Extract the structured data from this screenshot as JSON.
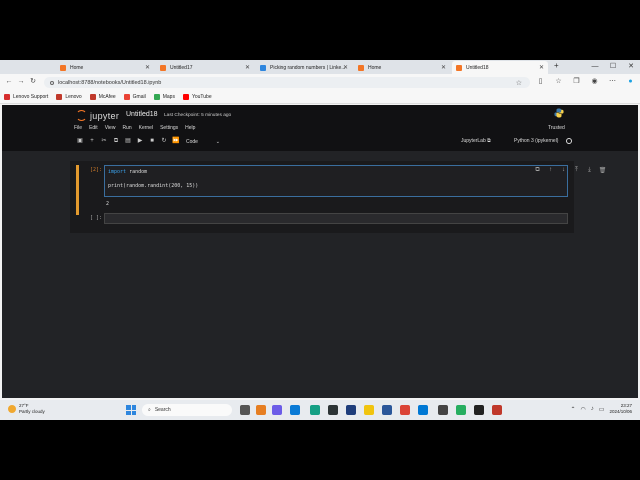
{
  "browser": {
    "tabs": [
      {
        "label": "Home",
        "color": "#f37626"
      },
      {
        "label": "Untitled17",
        "color": "#f37626"
      },
      {
        "label": "Picking random numbers | Linke...",
        "color": "#2e86de"
      },
      {
        "label": "Home",
        "color": "#f37626"
      },
      {
        "label": "Untitled18",
        "color": "#f37626"
      }
    ],
    "new_tab": "+",
    "url": "localhost:8788/notebooks/Untitled18.ipynb",
    "bookmarks": [
      {
        "label": "Lenovo Support",
        "color": "#d62d2d"
      },
      {
        "label": "Lenovo",
        "color": "#c0392b"
      },
      {
        "label": "McAfee",
        "color": "#c0392b"
      },
      {
        "label": "Gmail",
        "color": "#ea4335"
      },
      {
        "label": "Maps",
        "color": "#34a853"
      },
      {
        "label": "YouTube",
        "color": "#ff0000"
      }
    ]
  },
  "jupyter": {
    "logo_text": "jupyter",
    "notebook_title": "Untitled18",
    "checkpoint": "Last Checkpoint: 5 minutes ago",
    "trusted": "Trusted",
    "menu": [
      "File",
      "Edit",
      "View",
      "Run",
      "Kernel",
      "Settings",
      "Help"
    ],
    "cell_type": "Code",
    "jupyterlab_link": "JupyterLab",
    "kernel_name": "Python 3 (ipykernel)",
    "cells": [
      {
        "prompt": "[2]:",
        "line1_kw": "import",
        "line1_rest": " random",
        "line2": "print(random.randint(200, 15))",
        "output": "2"
      },
      {
        "prompt": "[ ]:"
      }
    ]
  },
  "taskbar": {
    "temperature": "27°F",
    "weather": "Partly cloudy",
    "search_placeholder": "Search",
    "time": "23:27",
    "date": "2024/10/06"
  }
}
